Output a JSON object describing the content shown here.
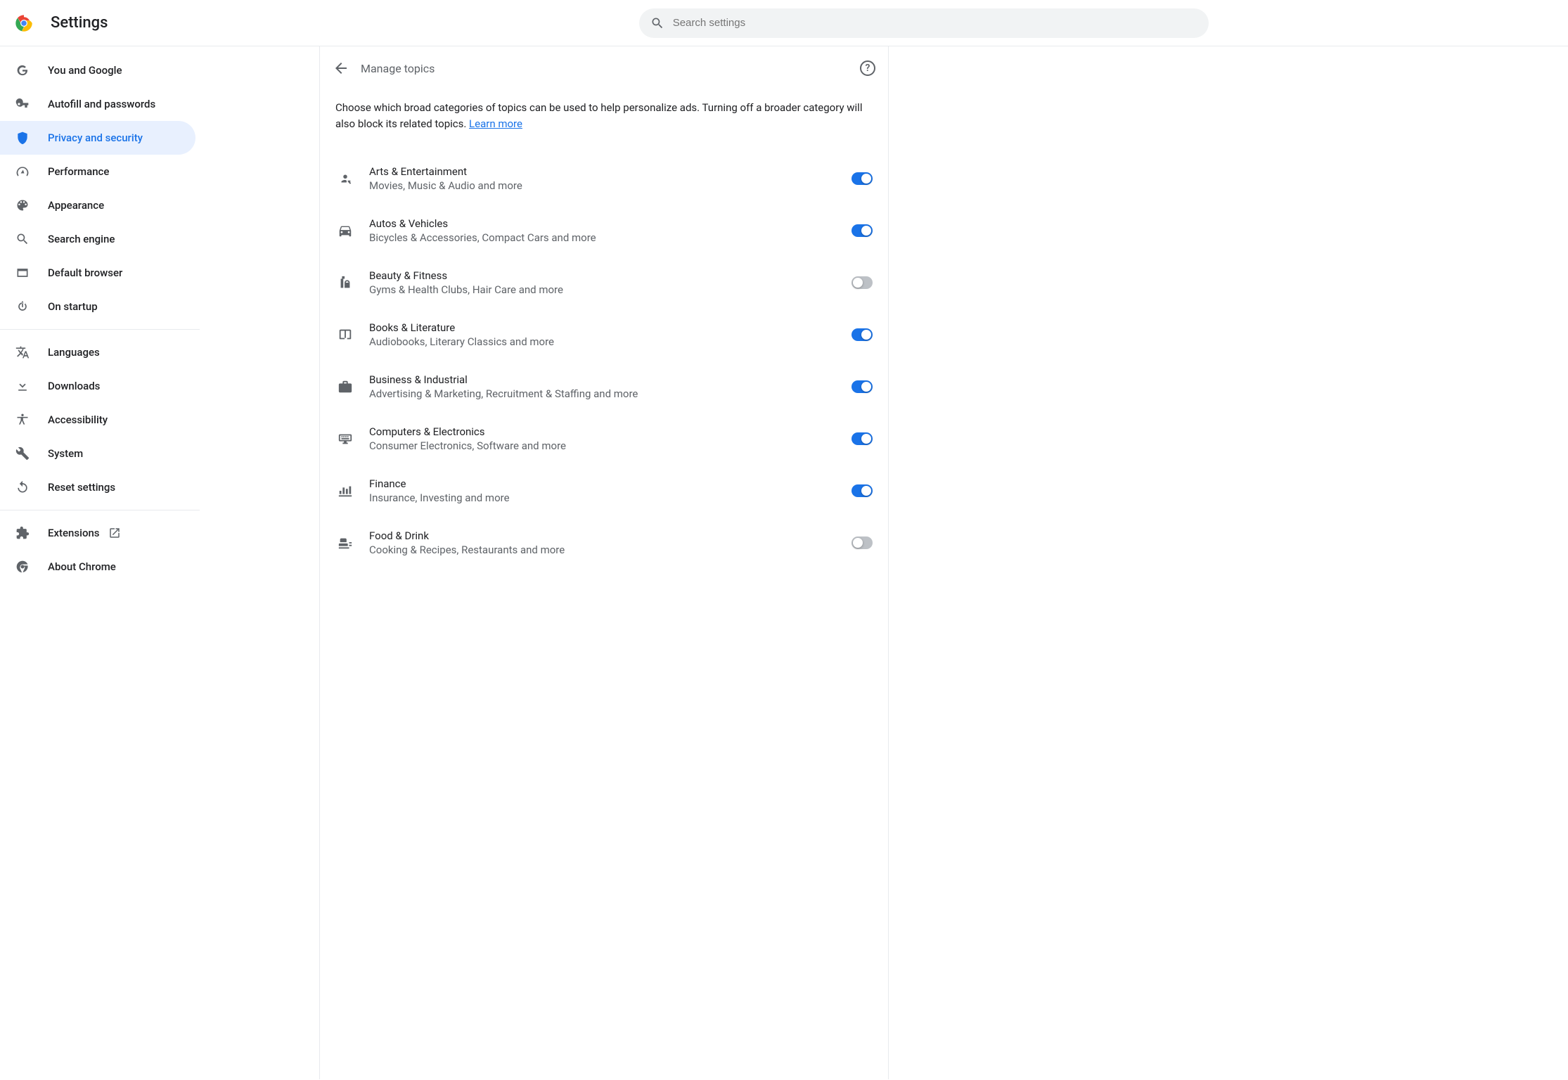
{
  "app": {
    "title": "Settings"
  },
  "search": {
    "placeholder": "Search settings"
  },
  "sidebar": {
    "items": [
      {
        "label": "You and Google"
      },
      {
        "label": "Autofill and passwords"
      },
      {
        "label": "Privacy and security"
      },
      {
        "label": "Performance"
      },
      {
        "label": "Appearance"
      },
      {
        "label": "Search engine"
      },
      {
        "label": "Default browser"
      },
      {
        "label": "On startup"
      }
    ],
    "items2": [
      {
        "label": "Languages"
      },
      {
        "label": "Downloads"
      },
      {
        "label": "Accessibility"
      },
      {
        "label": "System"
      },
      {
        "label": "Reset settings"
      }
    ],
    "items3": [
      {
        "label": "Extensions"
      },
      {
        "label": "About Chrome"
      }
    ]
  },
  "page": {
    "title": "Manage topics",
    "intro": "Choose which broad categories of topics can be used to help personalize ads. Turning off a broader category will also block its related topics. ",
    "learn_more": "Learn more"
  },
  "topics": [
    {
      "title": "Arts & Entertainment",
      "sub": "Movies, Music & Audio and more",
      "on": true
    },
    {
      "title": "Autos & Vehicles",
      "sub": "Bicycles & Accessories, Compact Cars and more",
      "on": true
    },
    {
      "title": "Beauty & Fitness",
      "sub": "Gyms & Health Clubs, Hair Care and more",
      "on": false
    },
    {
      "title": "Books & Literature",
      "sub": "Audiobooks, Literary Classics and more",
      "on": true
    },
    {
      "title": "Business & Industrial",
      "sub": "Advertising & Marketing, Recruitment & Staffing and more",
      "on": true
    },
    {
      "title": "Computers & Electronics",
      "sub": "Consumer Electronics, Software and more",
      "on": true
    },
    {
      "title": "Finance",
      "sub": "Insurance, Investing and more",
      "on": true
    },
    {
      "title": "Food & Drink",
      "sub": "Cooking & Recipes, Restaurants and more",
      "on": false
    }
  ]
}
